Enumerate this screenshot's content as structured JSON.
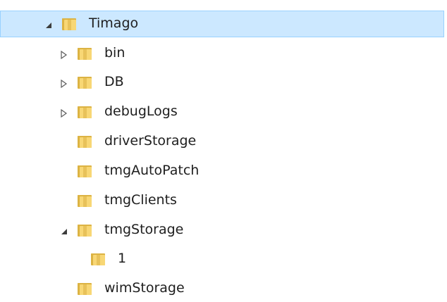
{
  "tree": {
    "nodes": [
      {
        "label": "Timago",
        "level": 0,
        "toggle": "expanded",
        "selected": true
      },
      {
        "label": "bin",
        "level": 1,
        "toggle": "collapsed",
        "selected": false
      },
      {
        "label": "DB",
        "level": 1,
        "toggle": "collapsed",
        "selected": false
      },
      {
        "label": "debugLogs",
        "level": 1,
        "toggle": "collapsed",
        "selected": false
      },
      {
        "label": "driverStorage",
        "level": 1,
        "toggle": "none",
        "selected": false
      },
      {
        "label": "tmgAutoPatch",
        "level": 1,
        "toggle": "none",
        "selected": false
      },
      {
        "label": "tmgClients",
        "level": 1,
        "toggle": "none",
        "selected": false
      },
      {
        "label": "tmgStorage",
        "level": 1,
        "toggle": "expanded",
        "selected": false
      },
      {
        "label": "1",
        "level": 2,
        "toggle": "none",
        "selected": false
      },
      {
        "label": "wimStorage",
        "level": 1,
        "toggle": "none",
        "selected": false
      }
    ]
  },
  "icons": {
    "folder": "folder-icon",
    "expanded": "expanded-arrow-icon",
    "collapsed": "collapsed-arrow-icon"
  },
  "colors": {
    "selection_bg": "#cce8ff",
    "selection_border": "#99d1ff",
    "folder_light": "#f8d775",
    "folder_dark": "#dcb343"
  }
}
